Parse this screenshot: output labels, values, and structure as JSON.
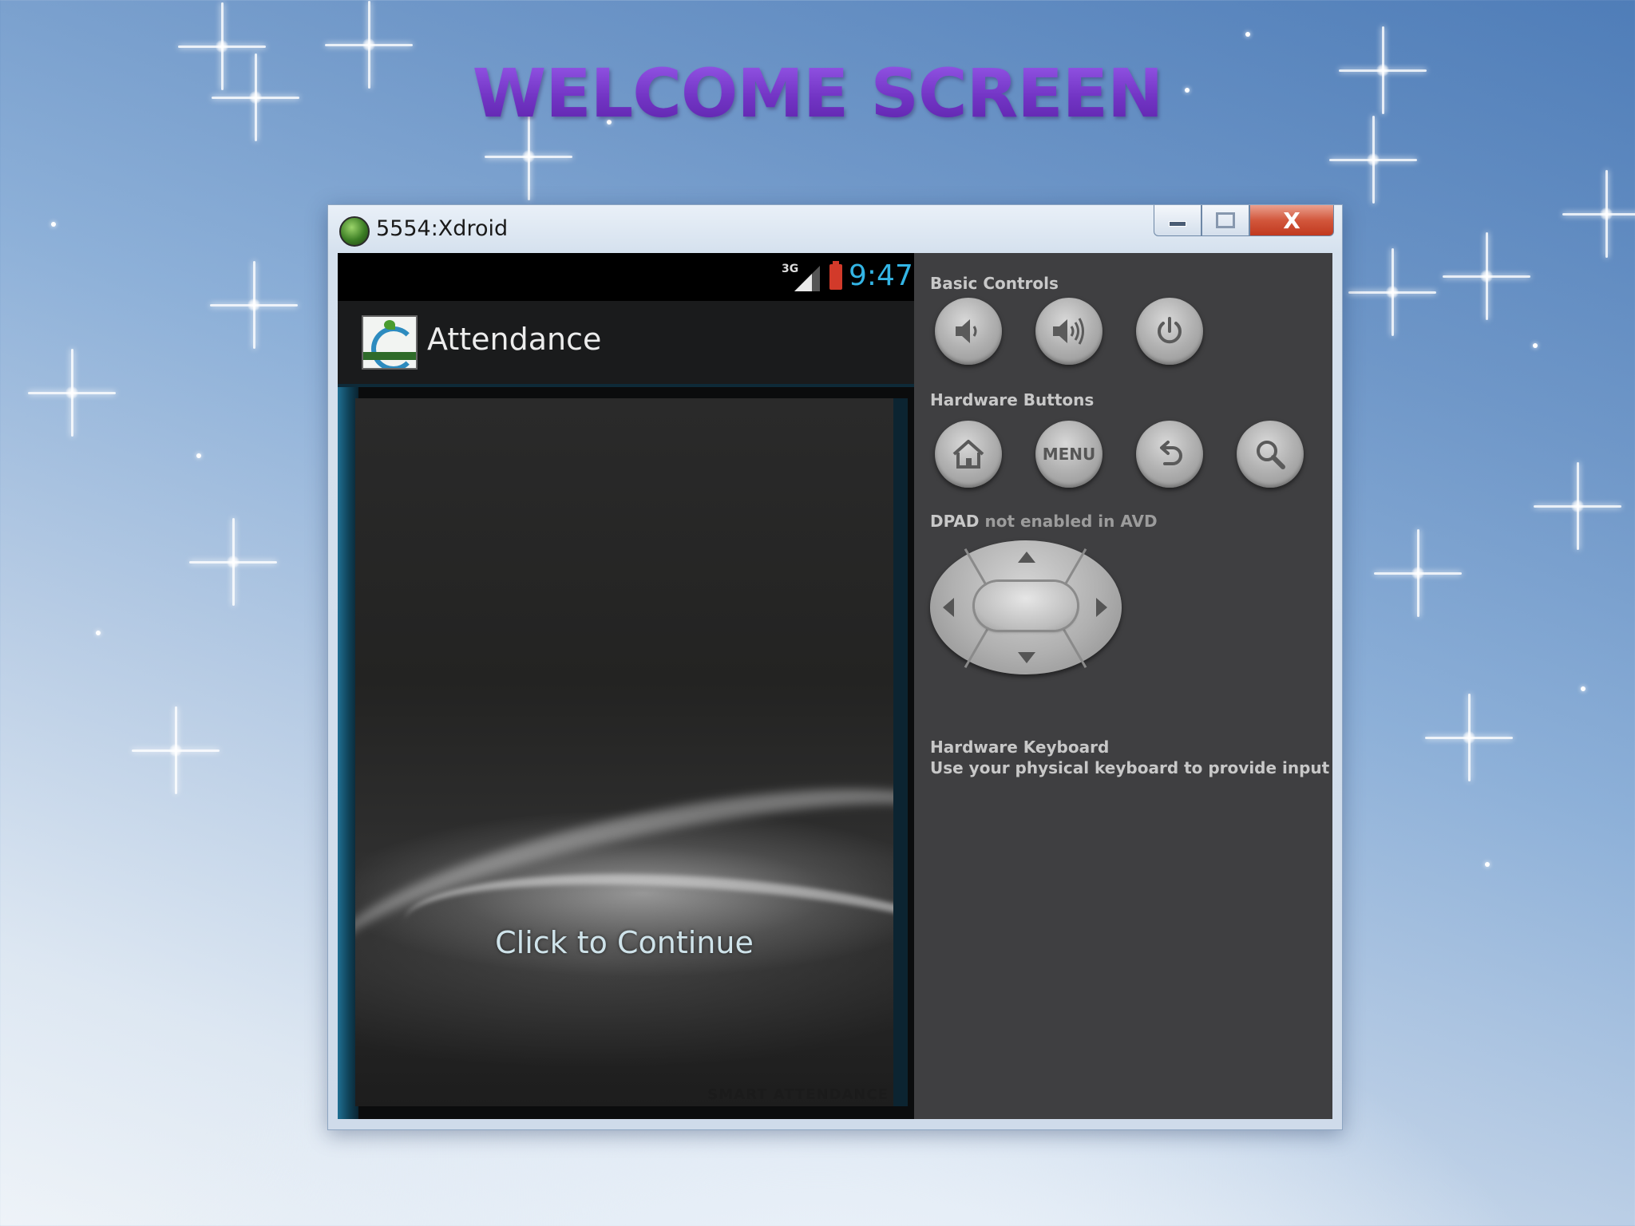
{
  "slide": {
    "title": "WELCOME SCREEN"
  },
  "window": {
    "title": "5554:Xdroid",
    "close_label": "X"
  },
  "phone": {
    "status": {
      "network": "3G",
      "time": "9:47"
    },
    "actionbar": {
      "app_name": "Attendance"
    },
    "content": {
      "continue_label": "Click to Continue",
      "footer_logo": "SMART ATTENDANCE"
    }
  },
  "controls": {
    "basic_label": "Basic Controls",
    "hardware_label": "Hardware Buttons",
    "menu_label": "MENU",
    "dpad_label_strong": "DPAD",
    "dpad_label_rest": " not enabled in AVD",
    "keyboard_title": "Hardware Keyboard",
    "keyboard_desc": "Use your physical keyboard to provide input"
  },
  "colors": {
    "title_purple": "#7a3fd0",
    "clock_blue": "#33b5e5",
    "panel_gray": "#3f3f41",
    "close_red": "#c1391f"
  }
}
